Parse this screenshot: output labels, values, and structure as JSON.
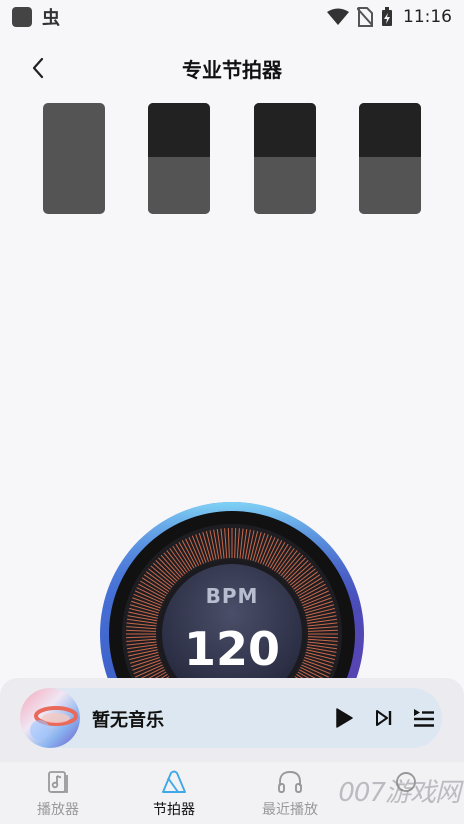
{
  "status_bar": {
    "app_glyph": "虫",
    "time": "11:16"
  },
  "header": {
    "title": "专业节拍器"
  },
  "beats": [
    {
      "accent": "full"
    },
    {
      "accent": "half"
    },
    {
      "accent": "half"
    },
    {
      "accent": "half"
    }
  ],
  "dial": {
    "label": "BPM",
    "value": "120"
  },
  "player": {
    "song_title": "暂无音乐"
  },
  "bottom_nav": {
    "items": [
      {
        "label": "播放器",
        "icon": "music-note-icon"
      },
      {
        "label": "节拍器",
        "icon": "metronome-icon"
      },
      {
        "label": "最近播放",
        "icon": "headphones-icon"
      }
    ]
  },
  "watermark": "007游戏网"
}
